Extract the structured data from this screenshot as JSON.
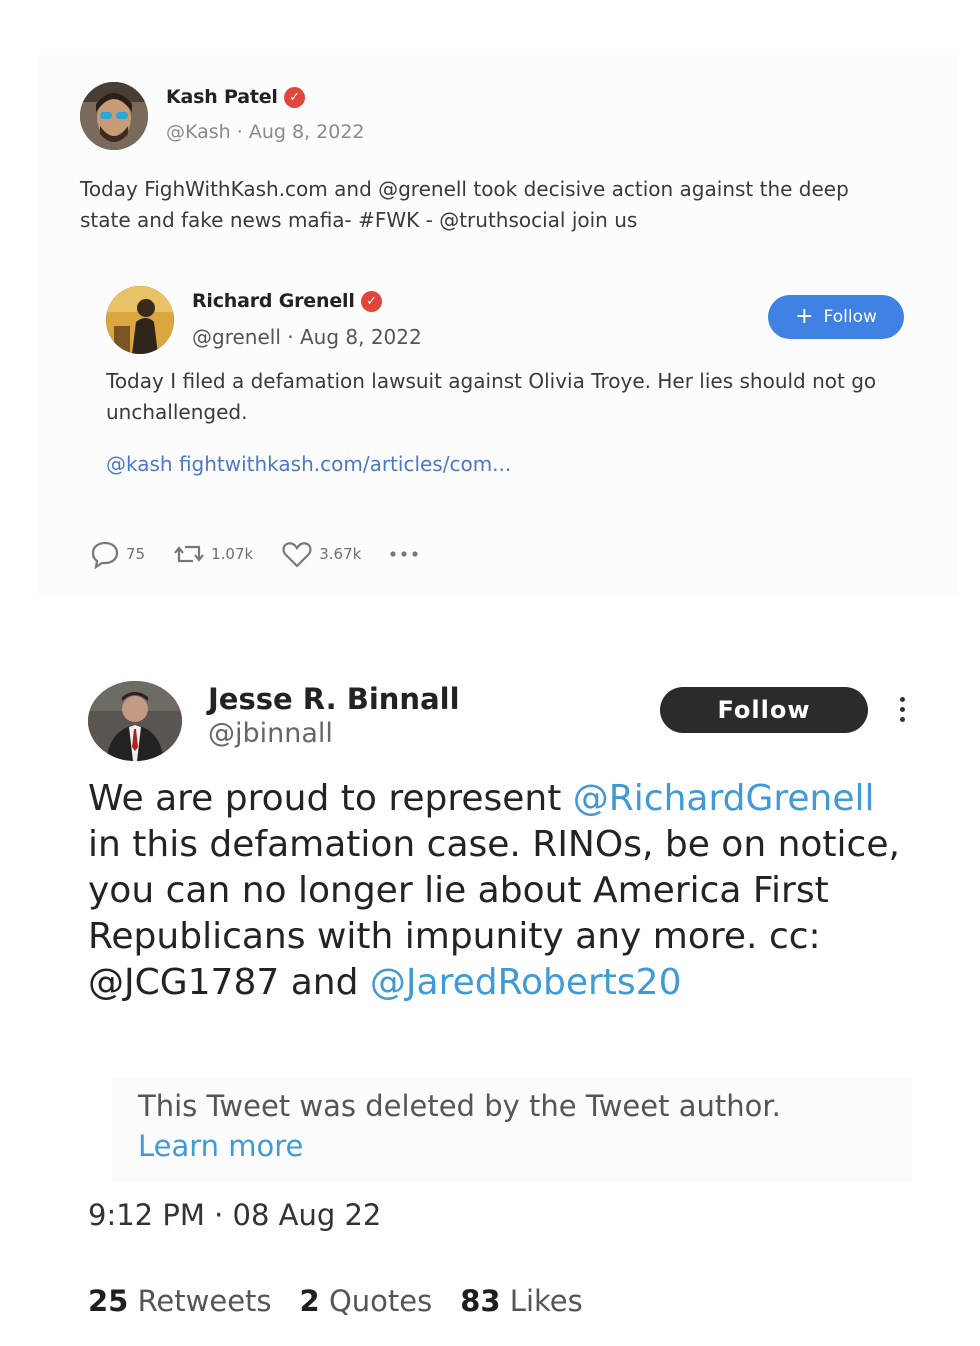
{
  "post1": {
    "author": {
      "name": "Kash Patel",
      "handle": "@Kash",
      "date": "Aug 8, 2022",
      "verified_color": "#e2453b"
    },
    "text": "Today FighWithKash.com and @grenell took decisive action against the deep state and fake news mafia- #FWK - @truthsocial join us",
    "quoted": {
      "name": "Richard Grenell",
      "handle": "@grenell",
      "date": "Aug 8, 2022",
      "follow_label": "Follow",
      "text": "Today I filed a defamation lawsuit against Olivia Troye. Her lies should not go unchallenged.",
      "link": "@kash fightwithkash.com/articles/com..."
    },
    "actions": {
      "replies": "75",
      "reposts": "1.07k",
      "likes": "3.67k",
      "more_icon": "ellipsis-icon"
    }
  },
  "post2": {
    "author": {
      "name": "Jesse R. Binnall",
      "handle": "@jbinnall"
    },
    "follow_label": "Follow",
    "text_parts": {
      "p1": "We are proud to represent ",
      "m1": "@RichardGrenell",
      "p2": " in this defamation case. RINOs, be on notice, you can no longer lie about America First Republicans with impunity any more. cc: @JCG1787 and ",
      "m2": "@JaredRoberts20"
    },
    "deleted_notice": "This Tweet was deleted by the Tweet author.",
    "learn_more": "Learn more",
    "timestamp": "9:12 PM · 08 Aug 22",
    "stats": {
      "retweets_count": "25",
      "retweets_label": "Retweets",
      "quotes_count": "2",
      "quotes_label": "Quotes",
      "likes_count": "83",
      "likes_label": "Likes"
    },
    "accent": "#3f9ad6"
  }
}
